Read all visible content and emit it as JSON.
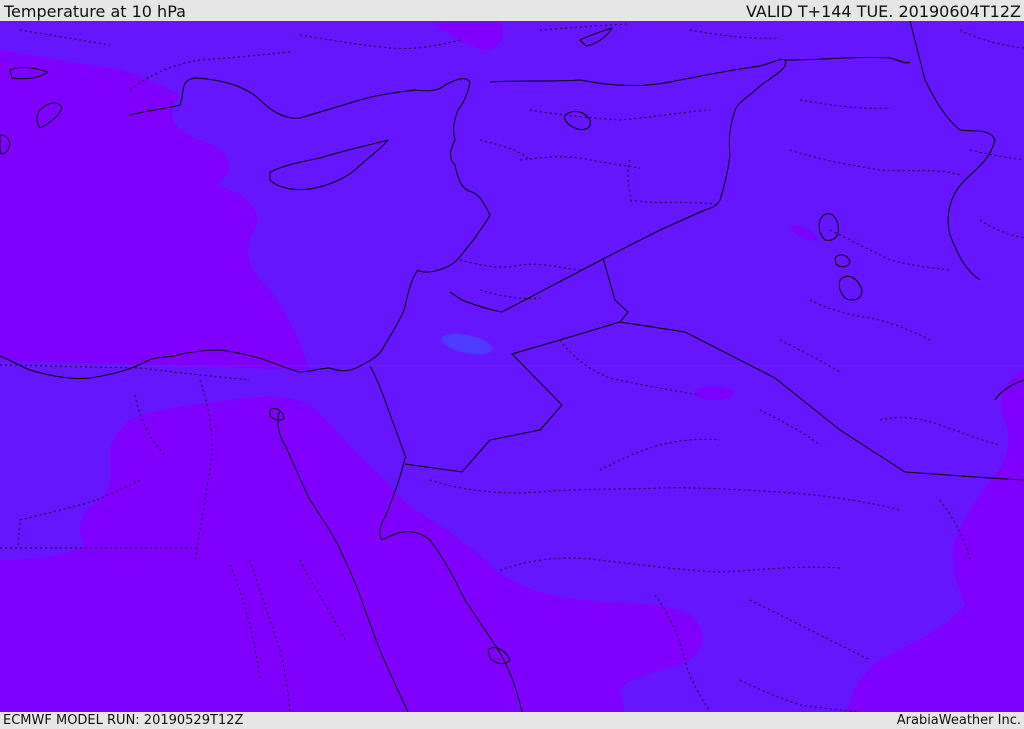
{
  "header": {
    "title": "Temperature at 10 hPa",
    "valid": "VALID T+144 TUE. 20190604T12Z"
  },
  "footer": {
    "model_run": "ECMWF MODEL RUN: 20190529T12Z",
    "credit": "ArabiaWeather Inc."
  },
  "map": {
    "colors": {
      "warmer_band": "#8000ff",
      "cooler_band": "#6615ff",
      "coldest_spot": "#4f3bff",
      "coastline": "#000000",
      "borders": "#000000"
    }
  }
}
